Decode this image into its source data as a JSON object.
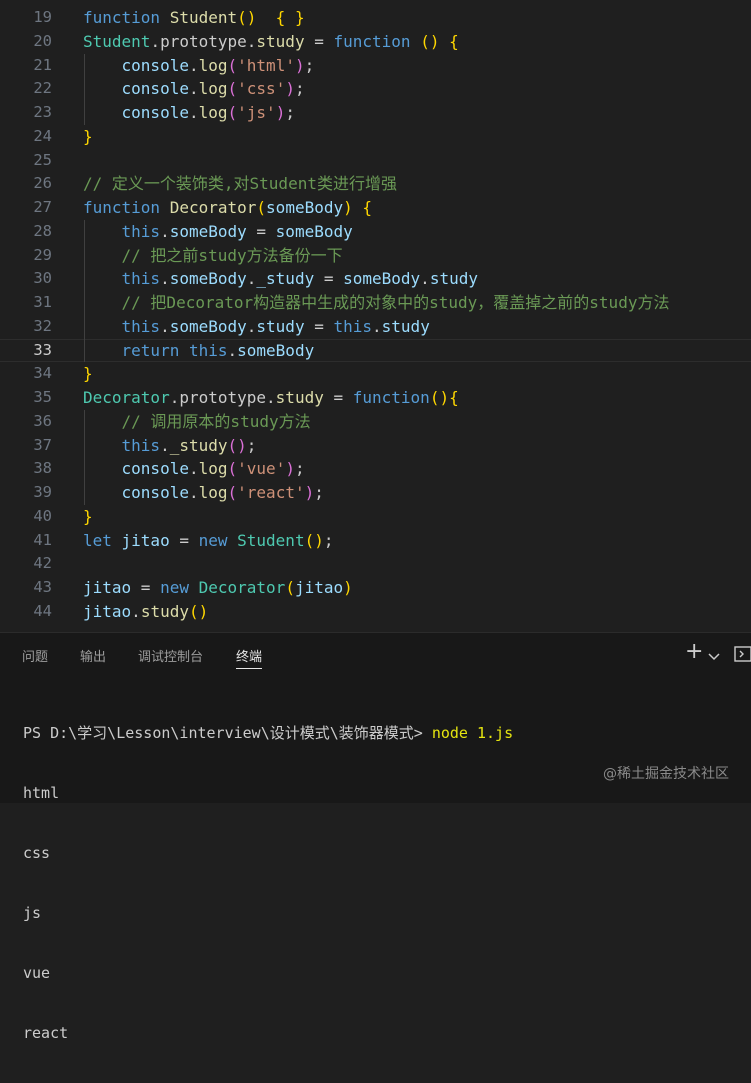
{
  "editor": {
    "lines": [
      {
        "n": "19",
        "tokens": [
          [
            "k",
            "function "
          ],
          [
            "f",
            "Student"
          ],
          [
            "p1",
            "()"
          ],
          [
            "",
            "  "
          ],
          [
            "p1",
            "{ }"
          ]
        ]
      },
      {
        "n": "20",
        "tokens": [
          [
            "c",
            "Student"
          ],
          [
            "",
            ".prototype."
          ],
          [
            "f",
            "study"
          ],
          [
            "",
            " = "
          ],
          [
            "k",
            "function"
          ],
          [
            "",
            " "
          ],
          [
            "p1",
            "()"
          ],
          [
            "",
            " "
          ],
          [
            "p1",
            "{"
          ]
        ]
      },
      {
        "n": "21",
        "tokens": [
          [
            "",
            "    "
          ],
          [
            "v",
            "console"
          ],
          [
            "",
            "."
          ],
          [
            "f",
            "log"
          ],
          [
            "p2",
            "("
          ],
          [
            "s",
            "'html'"
          ],
          [
            "p2",
            ")"
          ],
          [
            "",
            ";"
          ]
        ]
      },
      {
        "n": "22",
        "tokens": [
          [
            "",
            "    "
          ],
          [
            "v",
            "console"
          ],
          [
            "",
            "."
          ],
          [
            "f",
            "log"
          ],
          [
            "p2",
            "("
          ],
          [
            "s",
            "'css'"
          ],
          [
            "p2",
            ")"
          ],
          [
            "",
            ";"
          ]
        ]
      },
      {
        "n": "23",
        "tokens": [
          [
            "",
            "    "
          ],
          [
            "v",
            "console"
          ],
          [
            "",
            "."
          ],
          [
            "f",
            "log"
          ],
          [
            "p2",
            "("
          ],
          [
            "s",
            "'js'"
          ],
          [
            "p2",
            ")"
          ],
          [
            "",
            ";"
          ]
        ]
      },
      {
        "n": "24",
        "tokens": [
          [
            "p1",
            "}"
          ]
        ]
      },
      {
        "n": "25",
        "tokens": []
      },
      {
        "n": "26",
        "tokens": [
          [
            "cm",
            "// 定义一个装饰类,对Student类进行增强"
          ]
        ]
      },
      {
        "n": "27",
        "tokens": [
          [
            "k",
            "function "
          ],
          [
            "f",
            "Decorator"
          ],
          [
            "p1",
            "("
          ],
          [
            "v",
            "someBody"
          ],
          [
            "p1",
            ")"
          ],
          [
            "",
            " "
          ],
          [
            "p1",
            "{"
          ]
        ]
      },
      {
        "n": "28",
        "tokens": [
          [
            "",
            "    "
          ],
          [
            "k",
            "this"
          ],
          [
            "",
            "."
          ],
          [
            "v",
            "someBody"
          ],
          [
            "",
            " = "
          ],
          [
            "v",
            "someBody"
          ]
        ]
      },
      {
        "n": "29",
        "tokens": [
          [
            "",
            "    "
          ],
          [
            "cm",
            "// 把之前study方法备份一下"
          ]
        ]
      },
      {
        "n": "30",
        "tokens": [
          [
            "",
            "    "
          ],
          [
            "k",
            "this"
          ],
          [
            "",
            "."
          ],
          [
            "v",
            "someBody"
          ],
          [
            "",
            "."
          ],
          [
            "v",
            "_study"
          ],
          [
            "",
            " = "
          ],
          [
            "v",
            "someBody"
          ],
          [
            "",
            "."
          ],
          [
            "v",
            "study"
          ]
        ]
      },
      {
        "n": "31",
        "tokens": [
          [
            "",
            "    "
          ],
          [
            "cm",
            "// 把Decorator构造器中生成的对象中的study，覆盖掉之前的study方法"
          ]
        ]
      },
      {
        "n": "32",
        "tokens": [
          [
            "",
            "    "
          ],
          [
            "k",
            "this"
          ],
          [
            "",
            "."
          ],
          [
            "v",
            "someBody"
          ],
          [
            "",
            "."
          ],
          [
            "v",
            "study"
          ],
          [
            "",
            " = "
          ],
          [
            "k",
            "this"
          ],
          [
            "",
            "."
          ],
          [
            "v",
            "study"
          ]
        ]
      },
      {
        "n": "33",
        "tokens": [
          [
            "",
            "    "
          ],
          [
            "k",
            "return "
          ],
          [
            "k",
            "this"
          ],
          [
            "",
            "."
          ],
          [
            "v",
            "someBody"
          ]
        ]
      },
      {
        "n": "34",
        "tokens": [
          [
            "p1",
            "}"
          ]
        ]
      },
      {
        "n": "35",
        "tokens": [
          [
            "c",
            "Decorator"
          ],
          [
            "",
            ".prototype."
          ],
          [
            "f",
            "study"
          ],
          [
            "",
            " = "
          ],
          [
            "k",
            "function"
          ],
          [
            "p1",
            "(){"
          ]
        ]
      },
      {
        "n": "36",
        "tokens": [
          [
            "",
            "    "
          ],
          [
            "cm",
            "// 调用原本的study方法"
          ]
        ]
      },
      {
        "n": "37",
        "tokens": [
          [
            "",
            "    "
          ],
          [
            "k",
            "this"
          ],
          [
            "",
            "."
          ],
          [
            "f",
            "_study"
          ],
          [
            "p2",
            "()"
          ],
          [
            "",
            ";"
          ]
        ]
      },
      {
        "n": "38",
        "tokens": [
          [
            "",
            "    "
          ],
          [
            "v",
            "console"
          ],
          [
            "",
            "."
          ],
          [
            "f",
            "log"
          ],
          [
            "p2",
            "("
          ],
          [
            "s",
            "'vue'"
          ],
          [
            "p2",
            ")"
          ],
          [
            "",
            ";"
          ]
        ]
      },
      {
        "n": "39",
        "tokens": [
          [
            "",
            "    "
          ],
          [
            "v",
            "console"
          ],
          [
            "",
            "."
          ],
          [
            "f",
            "log"
          ],
          [
            "p2",
            "("
          ],
          [
            "s",
            "'react'"
          ],
          [
            "p2",
            ")"
          ],
          [
            "",
            ";"
          ]
        ]
      },
      {
        "n": "40",
        "tokens": [
          [
            "p1",
            "}"
          ]
        ]
      },
      {
        "n": "41",
        "tokens": [
          [
            "k",
            "let "
          ],
          [
            "v",
            "jitao"
          ],
          [
            "",
            " = "
          ],
          [
            "k",
            "new "
          ],
          [
            "c",
            "Student"
          ],
          [
            "p1",
            "()"
          ],
          [
            "",
            ";"
          ]
        ]
      },
      {
        "n": "42",
        "tokens": []
      },
      {
        "n": "43",
        "tokens": [
          [
            "v",
            "jitao"
          ],
          [
            "",
            " = "
          ],
          [
            "k",
            "new "
          ],
          [
            "c",
            "Decorator"
          ],
          [
            "p1",
            "("
          ],
          [
            "v",
            "jitao"
          ],
          [
            "p1",
            ")"
          ]
        ]
      },
      {
        "n": "44",
        "tokens": [
          [
            "v",
            "jitao"
          ],
          [
            "",
            "."
          ],
          [
            "f",
            "study"
          ],
          [
            "p1",
            "()"
          ]
        ]
      }
    ],
    "active_line": "33"
  },
  "panel": {
    "tabs": [
      {
        "label": "问题",
        "active": false
      },
      {
        "label": "输出",
        "active": false
      },
      {
        "label": "调试控制台",
        "active": false
      },
      {
        "label": "终端",
        "active": true
      }
    ],
    "icons": {
      "add": "plus-icon",
      "dropdown": "chevron-down-icon",
      "split": "split-terminal-icon"
    }
  },
  "terminal": {
    "prompt": "PS D:\\学习\\Lesson\\interview\\设计模式\\装饰器模式> ",
    "command": "node 1.js",
    "output": [
      "html",
      "css",
      "js",
      "vue",
      "react"
    ]
  },
  "watermark": "@稀土掘金技术社区",
  "colors": {
    "background": "#1f1f1f",
    "keyword": "#569cd6",
    "class": "#4ec9b0",
    "function": "#dcdcaa",
    "string": "#ce9178",
    "comment": "#6a9955"
  }
}
